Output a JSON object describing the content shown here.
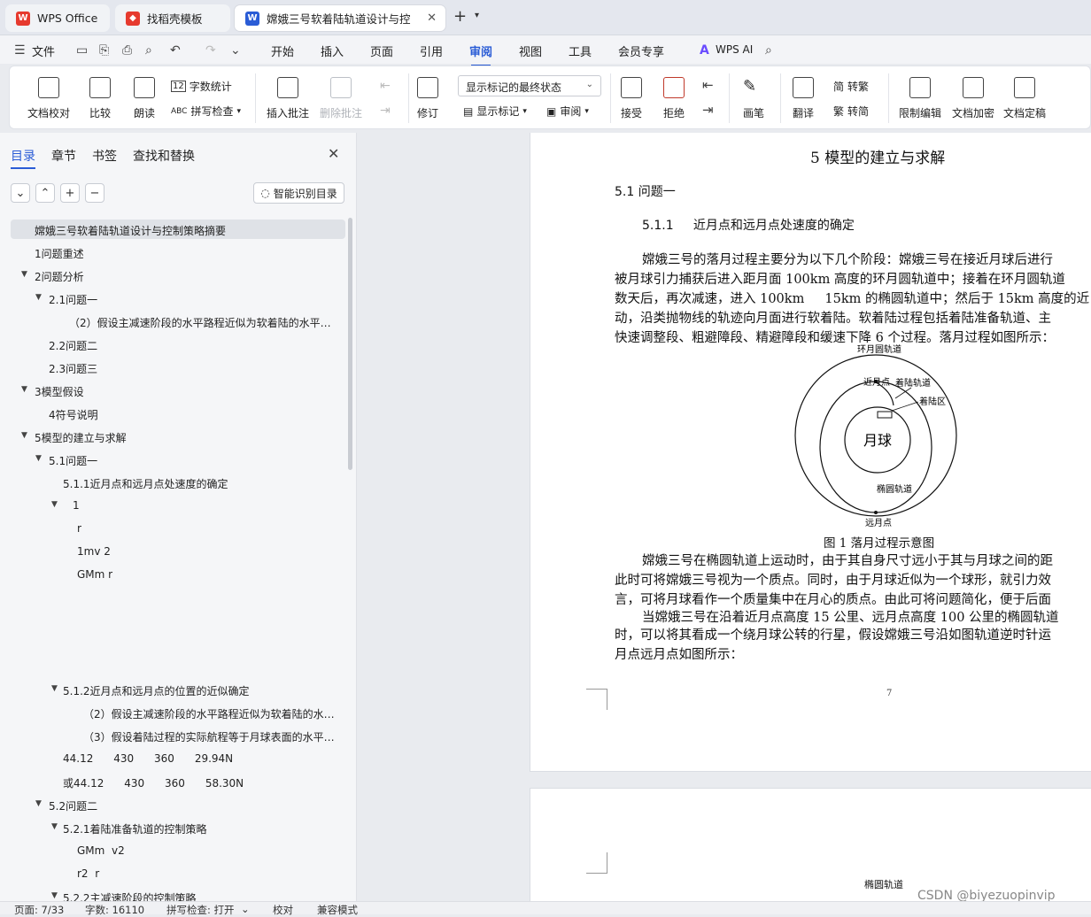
{
  "tabs": [
    {
      "label": "WPS Office",
      "icon": "wps-logo-icon",
      "color": "#e63a2e"
    },
    {
      "label": "找稻壳模板",
      "icon": "docer-icon",
      "color": "#e63a2e"
    },
    {
      "label": "嫦娥三号软着陆轨道设计与控",
      "icon": "word-doc-icon",
      "color": "#2a5cd6"
    }
  ],
  "menu": {
    "file": "文件",
    "items": [
      "开始",
      "插入",
      "页面",
      "引用",
      "审阅",
      "视图",
      "工具",
      "会员专享"
    ],
    "active": "审阅",
    "ai": "WPS AI"
  },
  "ribbon": {
    "doc_check": "文档校对",
    "compare": "比较",
    "read": "朗读",
    "word_count": "字数统计",
    "spell_check": "拼写检查",
    "insert_comment": "插入批注",
    "delete_comment": "删除批注",
    "revise": "修订",
    "markup_select": "显示标记的最终状态",
    "show_markup": "显示标记",
    "review": "审阅",
    "accept": "接受",
    "reject": "拒绝",
    "pen": "画笔",
    "translate": "翻译",
    "to_traditional": "转繁",
    "to_simplified": "转简",
    "restrict_edit": "限制编辑",
    "doc_encrypt": "文档加密",
    "doc_finalize": "文档定稿"
  },
  "nav": {
    "tabs": [
      "目录",
      "章节",
      "书签",
      "查找和替换"
    ],
    "smart_btn": "智能识别目录",
    "toc": [
      {
        "text": "嫦娥三号软着陆轨道设计与控制策略摘要",
        "selected": true
      },
      {
        "text": "1问题重述"
      },
      {
        "text": "2问题分析"
      },
      {
        "text": "2.1问题一"
      },
      {
        "text": "（2）假设主减速阶段的水平路程近似为软着陆的水平路 ..."
      },
      {
        "text": "2.2问题二"
      },
      {
        "text": "2.3问题三"
      },
      {
        "text": "3模型假设"
      },
      {
        "text": "4符号说明"
      },
      {
        "text": "5模型的建立与求解"
      },
      {
        "text": "5.1问题一"
      },
      {
        "text": "5.1.1近月点和远月点处速度的确定"
      },
      {
        "text": "1"
      },
      {
        "text": "r"
      },
      {
        "text": "1mv 2"
      },
      {
        "text": "GMm r"
      },
      {
        "text": "5.1.2近月点和远月点的位置的近似确定"
      },
      {
        "text": "（2）假设主减速阶段的水平路程近似为软着陆的水平 ..."
      },
      {
        "text": "（3）假设着陆过程的实际航程等于月球表面的水平路 ..."
      },
      {
        "text": "44.12      430      360      29.94N"
      },
      {
        "text": "或44.12      430      360      58.30N"
      },
      {
        "text": "5.2问题二"
      },
      {
        "text": "5.2.1着陆准备轨道的控制策略"
      },
      {
        "text": "GMm  v2"
      },
      {
        "text": "r2  r"
      },
      {
        "text": "5.2.2主减速阶段的控制策略"
      }
    ]
  },
  "doc": {
    "chapter": "5    模型的建立与求解",
    "sec": "5.1  问题一",
    "subsec": "5.1.1     近月点和远月点处速度的确定",
    "para1": [
      "嫦娥三号的落月过程主要分为以下几个阶段：嫦娥三号在接近月球后进行",
      "被月球引力捕获后进入距月面 100km 高度的环月圆轨道中；接着在环月圆轨道",
      "数天后，再次减速，进入 100km     15km 的椭圆轨道中；然后于 15km 高度的近",
      "动，沿类抛物线的轨迹向月面进行软着陆。软着陆过程包括着陆准备轨道、主",
      "快速调整段、粗避障段、精避障段和缓速下降 6 个过程。落月过程如图所示："
    ],
    "figure": {
      "outer": "环月圆轨道",
      "perilune": "近月点",
      "landing_orbit": "着陆轨道",
      "landing_zone": "着陆区",
      "moon": "月球",
      "ellipse": "椭圆轨道",
      "apolune": "远月点",
      "caption": "图 1 落月过程示意图"
    },
    "para2": [
      "嫦娥三号在椭圆轨道上运动时，由于其自身尺寸远小于其与月球之间的距",
      "此时可将嫦娥三号视为一个质点。同时，由于月球近似为一个球形，就引力效",
      "言，可将月球看作一个质量集中在月心的质点。由此可将问题简化，便于后面",
      "当嫦娥三号在沿着近月点高度 15 公里、远月点高度 100 公里的椭圆轨道",
      "时，可以将其看成一个绕月球公转的行星，假设嫦娥三号沿如图轨道逆时针运",
      "月点远月点如图所示："
    ],
    "page_num": "7",
    "next_page_label": "椭圆轨道"
  },
  "status": {
    "page": "页面: 7/33",
    "words": "字数: 16110",
    "spell": "拼写检查: 打开",
    "proof": "校对",
    "compat": "兼容模式"
  },
  "watermark": "CSDN @biyezuopinvip"
}
